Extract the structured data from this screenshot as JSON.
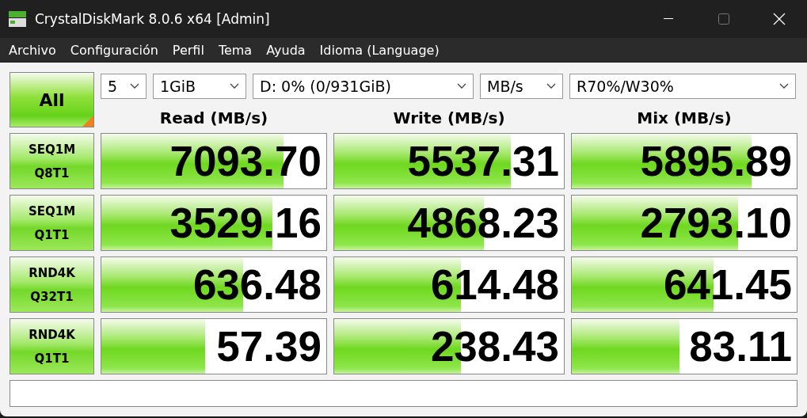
{
  "window": {
    "title": "CrystalDiskMark 8.0.6 x64 [Admin]"
  },
  "menu": [
    "Archivo",
    "Configuración",
    "Perfil",
    "Tema",
    "Ayuda",
    "Idioma (Language)"
  ],
  "all_button": {
    "label": "All"
  },
  "selectors": [
    {
      "value": "5"
    },
    {
      "value": "1GiB"
    },
    {
      "value": "D: 0% (0/931GiB)"
    },
    {
      "value": "MB/s"
    },
    {
      "value": "R70%/W30%"
    }
  ],
  "columns": [
    "Read (MB/s)",
    "Write (MB/s)",
    "Mix (MB/s)"
  ],
  "rows": [
    {
      "test": [
        "SEQ1M",
        "Q8T1"
      ],
      "results": [
        {
          "value": "7093.70",
          "level": 0.81
        },
        {
          "value": "5537.31",
          "level": 0.77
        },
        {
          "value": "5895.89",
          "level": 0.8
        }
      ]
    },
    {
      "test": [
        "SEQ1M",
        "Q1T1"
      ],
      "results": [
        {
          "value": "3529.16",
          "level": 0.76
        },
        {
          "value": "4868.23",
          "level": 0.65
        },
        {
          "value": "2793.10",
          "level": 0.74
        }
      ]
    },
    {
      "test": [
        "RND4K",
        "Q32T1"
      ],
      "results": [
        {
          "value": "636.48",
          "level": 0.63
        },
        {
          "value": "614.48",
          "level": 0.55
        },
        {
          "value": "641.45",
          "level": 0.63
        }
      ]
    },
    {
      "test": [
        "RND4K",
        "Q1T1"
      ],
      "results": [
        {
          "value": "57.39",
          "level": 0.46
        },
        {
          "value": "238.43",
          "level": 0.55
        },
        {
          "value": "83.11",
          "level": 0.48
        }
      ]
    }
  ]
}
